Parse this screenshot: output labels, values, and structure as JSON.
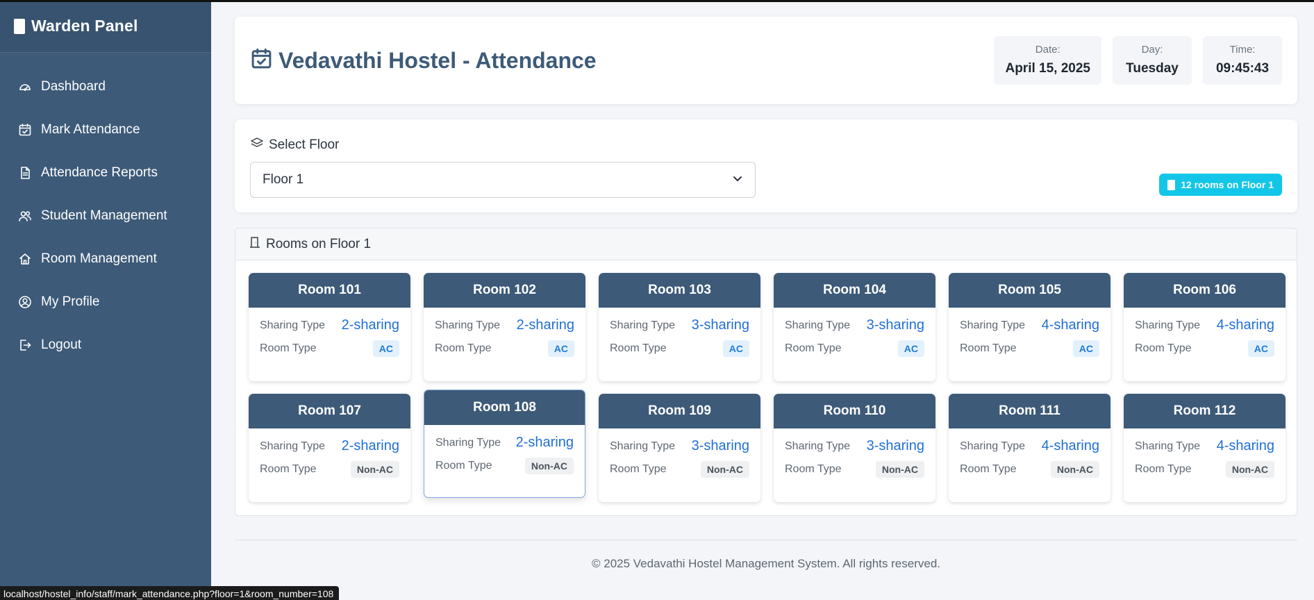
{
  "sidebar": {
    "title": "Warden Panel",
    "items": [
      {
        "label": "Dashboard",
        "icon": "gauge-icon"
      },
      {
        "label": "Mark Attendance",
        "icon": "calendar-check-icon"
      },
      {
        "label": "Attendance Reports",
        "icon": "document-icon"
      },
      {
        "label": "Student Management",
        "icon": "users-icon"
      },
      {
        "label": "Room Management",
        "icon": "home-icon"
      },
      {
        "label": "My Profile",
        "icon": "user-circle-icon"
      },
      {
        "label": "Logout",
        "icon": "logout-icon"
      }
    ]
  },
  "header": {
    "title": "Vedavathi Hostel - Attendance",
    "date_label": "Date:",
    "date_value": "April 15, 2025",
    "day_label": "Day:",
    "day_value": "Tuesday",
    "time_label": "Time:",
    "time_value": "09:45:43"
  },
  "floor_select": {
    "label": "Select Floor",
    "value": "Floor 1",
    "badge": "12 rooms on Floor 1"
  },
  "rooms": {
    "heading": "Rooms on Floor 1",
    "sharing_label": "Sharing Type",
    "type_label": "Room Type",
    "list": [
      {
        "name": "Room 101",
        "sharing": "2-sharing",
        "type": "AC"
      },
      {
        "name": "Room 102",
        "sharing": "2-sharing",
        "type": "AC"
      },
      {
        "name": "Room 103",
        "sharing": "3-sharing",
        "type": "AC"
      },
      {
        "name": "Room 104",
        "sharing": "3-sharing",
        "type": "AC"
      },
      {
        "name": "Room 105",
        "sharing": "4-sharing",
        "type": "AC"
      },
      {
        "name": "Room 106",
        "sharing": "4-sharing",
        "type": "AC"
      },
      {
        "name": "Room 107",
        "sharing": "2-sharing",
        "type": "Non-AC"
      },
      {
        "name": "Room 108",
        "sharing": "2-sharing",
        "type": "Non-AC"
      },
      {
        "name": "Room 109",
        "sharing": "3-sharing",
        "type": "Non-AC"
      },
      {
        "name": "Room 110",
        "sharing": "3-sharing",
        "type": "Non-AC"
      },
      {
        "name": "Room 111",
        "sharing": "4-sharing",
        "type": "Non-AC"
      },
      {
        "name": "Room 112",
        "sharing": "4-sharing",
        "type": "Non-AC"
      }
    ]
  },
  "footer": {
    "text": "© 2025 Vedavathi Hostel Management System. All rights reserved."
  },
  "status_bar": {
    "url": "localhost/hostel_info/staff/mark_attendance.php?floor=1&room_number=108"
  },
  "colors": {
    "sidebar": "#3d5a78",
    "accent": "#1f6fd6",
    "badge": "#13c6e8"
  }
}
